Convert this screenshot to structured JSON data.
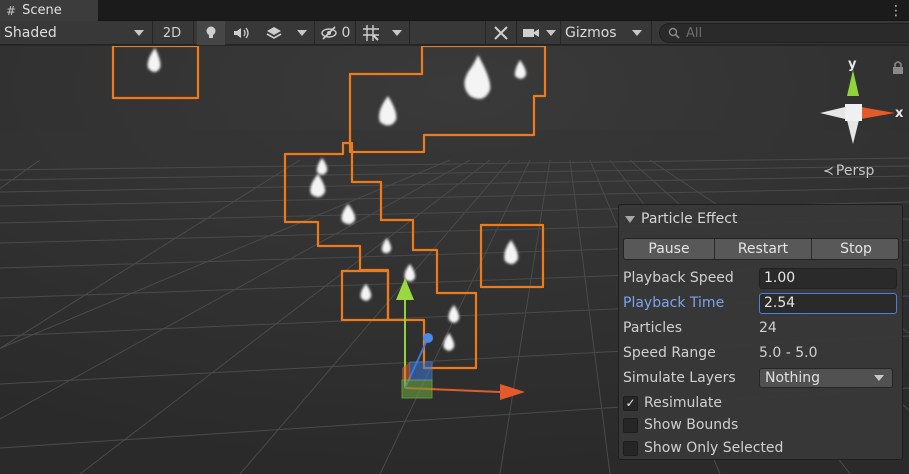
{
  "tab": {
    "label": "Scene",
    "icon": "grid-icon",
    "menu_icon": "kebab-menu-icon"
  },
  "toolbar": {
    "shading_mode": "Shaded",
    "mode_2d": "2D",
    "hidden_count": "0",
    "gizmos_label": "Gizmos",
    "search_placeholder": "All"
  },
  "orientation": {
    "y_axis": "y",
    "x_axis": "x",
    "projection": "Persp",
    "colors": {
      "y": "#8fd43a",
      "x": "#e55a2b",
      "z": "#3b78d8"
    }
  },
  "particle_panel": {
    "title": "Particle Effect",
    "buttons": {
      "pause": "Pause",
      "restart": "Restart",
      "stop": "Stop"
    },
    "playback_speed": {
      "label": "Playback Speed",
      "value": "1.00"
    },
    "playback_time": {
      "label": "Playback Time",
      "value": "2.54"
    },
    "particles": {
      "label": "Particles",
      "value": "24"
    },
    "speed_range": {
      "label": "Speed Range",
      "value": "5.0 - 5.0"
    },
    "simulate_layers": {
      "label": "Simulate Layers",
      "value": "Nothing"
    },
    "resimulate": {
      "label": "Resimulate",
      "checked": true
    },
    "show_bounds": {
      "label": "Show Bounds",
      "checked": false
    },
    "show_only_selected": {
      "label": "Show Only Selected",
      "checked": false
    }
  },
  "colors": {
    "selection_outline": "#ef7a1a",
    "viewport_bg": "#2c2c2c",
    "active_label": "#7ba4ea"
  }
}
